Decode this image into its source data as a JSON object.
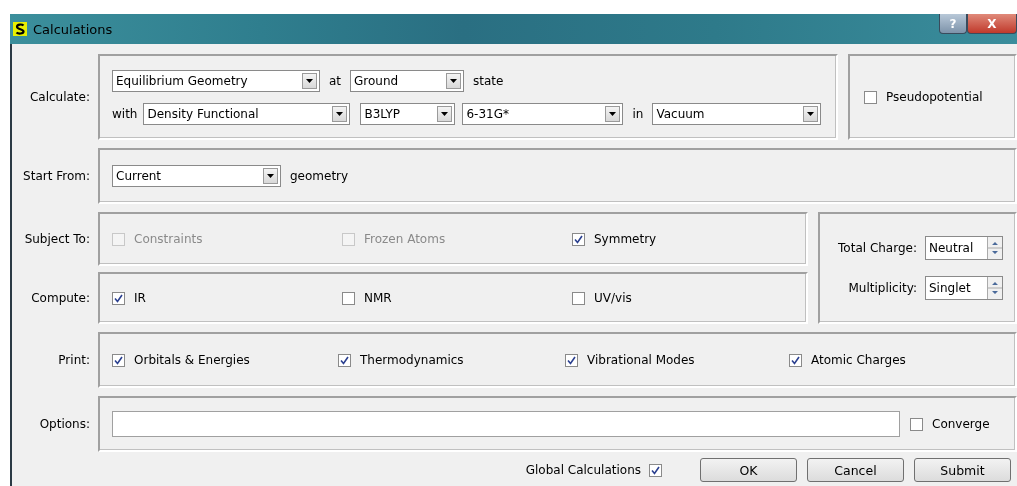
{
  "window": {
    "title": "Calculations",
    "help_button": "?",
    "close_button": "X"
  },
  "calculate": {
    "label": "Calculate:",
    "task": "Equilibrium Geometry",
    "at": "at",
    "state": "Ground",
    "state_word": "state",
    "with": "with",
    "method": "Density Functional",
    "functional": "B3LYP",
    "basis": "6-31G*",
    "in": "in",
    "solvent": "Vacuum",
    "pseudopotential": {
      "label": "Pseudopotential",
      "checked": false,
      "disabled": false
    }
  },
  "start_from": {
    "label": "Start From:",
    "value": "Current",
    "suffix": "geometry"
  },
  "subject_to": {
    "label": "Subject To:",
    "options": [
      {
        "label": "Constraints",
        "checked": false,
        "disabled": true
      },
      {
        "label": "Frozen Atoms",
        "checked": false,
        "disabled": true
      },
      {
        "label": "Symmetry",
        "checked": true,
        "disabled": false
      }
    ]
  },
  "compute": {
    "label": "Compute:",
    "options": [
      {
        "label": "IR",
        "checked": true,
        "disabled": false
      },
      {
        "label": "NMR",
        "checked": false,
        "disabled": false
      },
      {
        "label": "UV/vis",
        "checked": false,
        "disabled": false
      }
    ]
  },
  "total_charge": {
    "label": "Total Charge:",
    "value": "Neutral"
  },
  "multiplicity": {
    "label": "Multiplicity:",
    "value": "Singlet"
  },
  "print": {
    "label": "Print:",
    "options": [
      {
        "label": "Orbitals & Energies",
        "checked": true,
        "disabled": false
      },
      {
        "label": "Thermodynamics",
        "checked": true,
        "disabled": false
      },
      {
        "label": "Vibrational Modes",
        "checked": true,
        "disabled": false
      },
      {
        "label": "Atomic Charges",
        "checked": true,
        "disabled": false
      }
    ]
  },
  "options": {
    "label": "Options:",
    "converge": {
      "label": "Converge",
      "checked": false,
      "disabled": false
    }
  },
  "global_calculations": {
    "label": "Global Calculations",
    "checked": true
  },
  "buttons": [
    "OK",
    "Cancel",
    "Submit"
  ]
}
